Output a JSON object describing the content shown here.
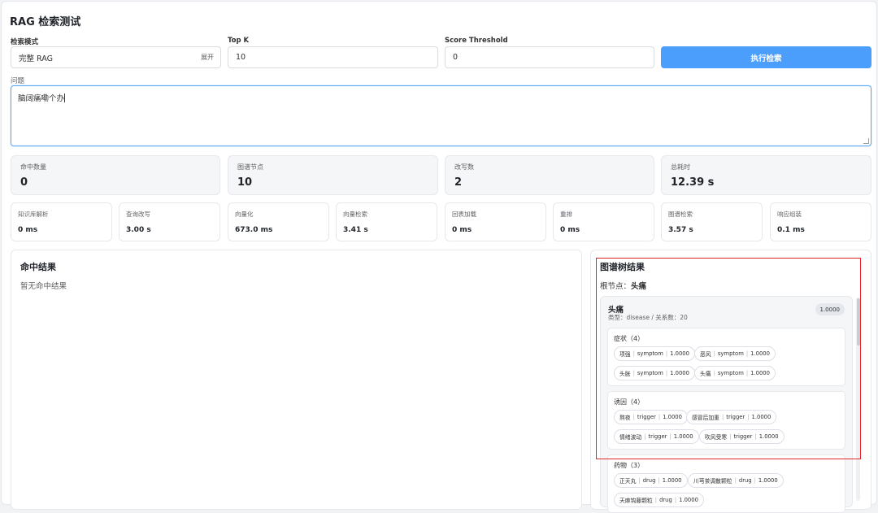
{
  "title": "RAG 检索测试",
  "form": {
    "mode_label": "检索模式",
    "mode_value": "完整 RAG",
    "mode_expand": "展开",
    "topk_label": "Top K",
    "topk_value": "10",
    "threshold_label": "Score Threshold",
    "threshold_value": "0",
    "submit_label": "执行检索",
    "question_label": "问题",
    "question_value": "脑阔痛嘞个办"
  },
  "stats": [
    {
      "label": "命中数量",
      "value": "0"
    },
    {
      "label": "图谱节点",
      "value": "10"
    },
    {
      "label": "改写数",
      "value": "2"
    },
    {
      "label": "总耗时",
      "value": "12.39 s"
    }
  ],
  "timings": [
    {
      "label": "知识库解析",
      "value": "0 ms"
    },
    {
      "label": "查询改写",
      "value": "3.00 s"
    },
    {
      "label": "向量化",
      "value": "673.0 ms"
    },
    {
      "label": "向量检索",
      "value": "3.41 s"
    },
    {
      "label": "回表加载",
      "value": "0 ms"
    },
    {
      "label": "重排",
      "value": "0 ms"
    },
    {
      "label": "图谱检索",
      "value": "3.57 s"
    },
    {
      "label": "响应组装",
      "value": "0.1 ms"
    }
  ],
  "hits": {
    "title": "命中结果",
    "empty": "暂无命中结果"
  },
  "graph": {
    "title": "图谱树结果",
    "root_label": "根节点：",
    "root_value": "头痛",
    "node": {
      "name": "头痛",
      "meta": "类型：disease / 关系数：20",
      "score": "1.0000"
    },
    "groups": [
      {
        "title": "症状（4）",
        "chips": [
          {
            "name": "项强",
            "type": "symptom",
            "score": "1.0000"
          },
          {
            "name": "恶风",
            "type": "symptom",
            "score": "1.0000"
          },
          {
            "name": "头胀",
            "type": "symptom",
            "score": "1.0000"
          },
          {
            "name": "头痛",
            "type": "symptom",
            "score": "1.0000"
          }
        ]
      },
      {
        "title": "诱因（4）",
        "chips": [
          {
            "name": "熬夜",
            "type": "trigger",
            "score": "1.0000"
          },
          {
            "name": "感冒后加重",
            "type": "trigger",
            "score": "1.0000"
          },
          {
            "name": "情绪波动",
            "type": "trigger",
            "score": "1.0000"
          },
          {
            "name": "吹风受寒",
            "type": "trigger",
            "score": "1.0000"
          }
        ]
      },
      {
        "title": "药物（3）",
        "chips": [
          {
            "name": "正天丸",
            "type": "drug",
            "score": "1.0000"
          },
          {
            "name": "川芎茶调散颗粒",
            "type": "drug",
            "score": "1.0000"
          },
          {
            "name": "天麻钩藤颗粒",
            "type": "drug",
            "score": "1.0000"
          }
        ]
      }
    ]
  },
  "colors": {
    "primary": "#4c9efc",
    "highlight": "#e0262b"
  }
}
